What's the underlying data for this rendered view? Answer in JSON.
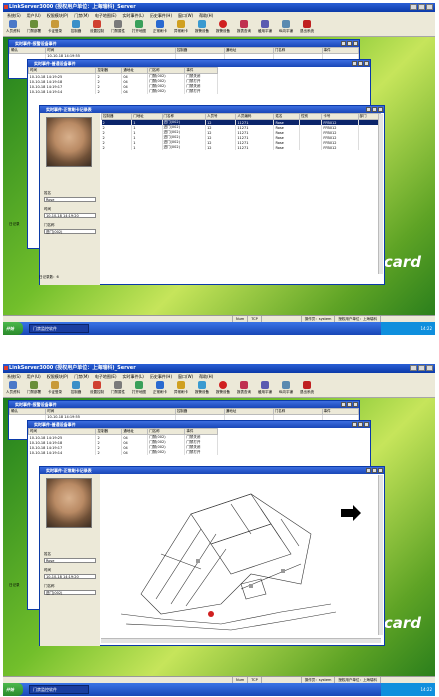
{
  "app": {
    "title": "LinkServer3000 (授权用户单位：上海瑞科)_Server",
    "menu": [
      "系统(S)",
      "用户(U)",
      "权限模块(P)",
      "门禁(M)",
      "电子地图(E)",
      "实时事件(L)",
      "历史事件(H)",
      "窗口(W)",
      "帮助(H)"
    ],
    "toolbar": [
      "人员资料",
      "门禁部署",
      "卡证登录",
      "控制器",
      "设置控制",
      "门禁属性",
      "打开地图",
      "正常刷卡",
      "异常刷卡",
      "报警设备",
      "报警设备",
      "报表查询",
      "缓用平铺",
      "纵向平铺",
      "退出系统"
    ],
    "brand": "Linkcard",
    "status": [
      "Num",
      "TCP",
      "操作员：system",
      "授权用户单位：上海瑞科"
    ],
    "start_label": "开始",
    "task_label": "门禁监控软件",
    "clock": "14:22",
    "accent": "#0b3aa8"
  },
  "windows": {
    "alarm": {
      "title": "实时事件-报警设备事件",
      "headers": [
        "确认",
        "时间",
        "控制器",
        "通地址",
        "门名称",
        "事件"
      ],
      "row": [
        "",
        "10-10-18 14:19:55",
        "",
        "",
        "",
        ""
      ]
    },
    "normal": {
      "title": "实时事件-普通设备事件",
      "headers": [
        "时间",
        "控制器",
        "通地址",
        "门名称",
        "事件"
      ],
      "rows": [
        [
          "10-10-18 14:19:25",
          "2",
          "04",
          "门禁(002)",
          "门禁关闭"
        ],
        [
          "10-10-18 14:19:18",
          "2",
          "04",
          "门禁(002)",
          "门禁打开"
        ],
        [
          "10-10-18 14:19:17",
          "2",
          "04",
          "门禁(002)",
          "门禁关闭"
        ],
        [
          "10-10-18 14:19:14",
          "2",
          "04",
          "门禁(002)",
          "门禁打开"
        ]
      ],
      "side_label": "日记录"
    },
    "card": {
      "title": "实时事件-正常刷卡记录表",
      "headers": [
        "控制器",
        "门地址",
        "门名称",
        "人员号",
        "人员编码",
        "姓名",
        "性别",
        "卡号",
        "部门"
      ],
      "rows": [
        [
          "2",
          "1",
          "进门(002)",
          "12",
          "11271",
          "Rose",
          "",
          "FFB012",
          ""
        ],
        [
          "2",
          "1",
          "进门(002)",
          "12",
          "11271",
          "Rose",
          "",
          "FFB012",
          ""
        ],
        [
          "2",
          "1",
          "进门(002)",
          "12",
          "11271",
          "Rose",
          "",
          "FFB012",
          ""
        ],
        [
          "2",
          "1",
          "进门(002)",
          "12",
          "11271",
          "Rose",
          "",
          "FFB012",
          ""
        ],
        [
          "2",
          "1",
          "进门(002)",
          "12",
          "11271",
          "Rose",
          "",
          "FFB012",
          ""
        ],
        [
          "2",
          "1",
          "进门(002)",
          "12",
          "11271",
          "Rose",
          "",
          "FFB012",
          ""
        ]
      ],
      "person": {
        "name_label": "姓名",
        "name": "Rose",
        "time_label": "时间",
        "time": "10-10-18 14:19:20",
        "door_label": "门名称",
        "door": "进门(002)"
      },
      "footer": "日记录数：6"
    }
  }
}
